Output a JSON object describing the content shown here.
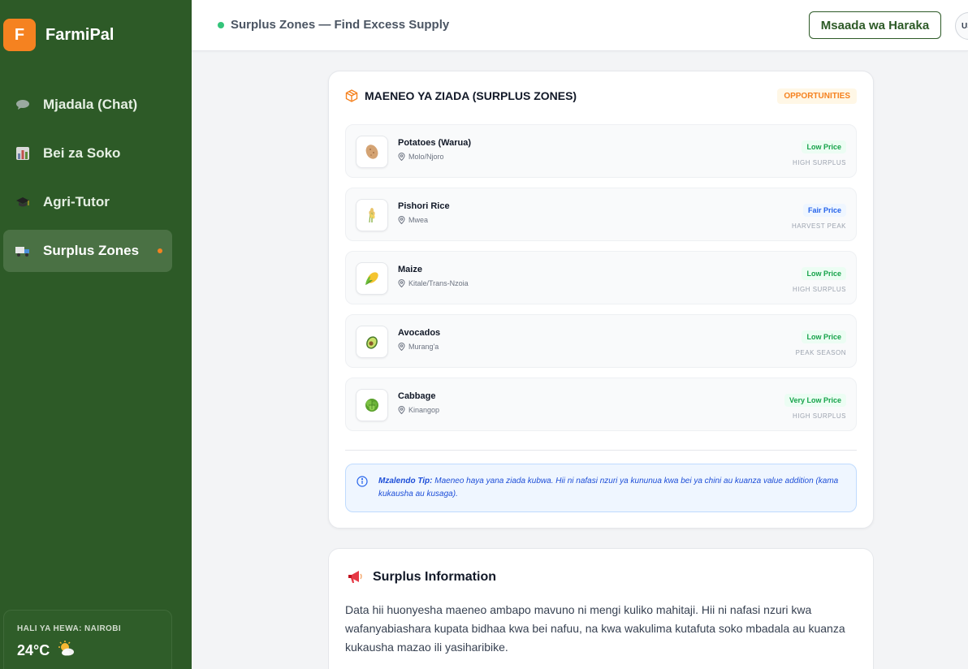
{
  "brand": {
    "logo_letter": "F",
    "name": "FarmiPal"
  },
  "sidebar": {
    "items": [
      {
        "label": "Mjadala (Chat)",
        "icon": "chat-bubble-icon"
      },
      {
        "label": "Bei za Soko",
        "icon": "chart-icon"
      },
      {
        "label": "Agri-Tutor",
        "icon": "graduation-cap-icon"
      },
      {
        "label": "Surplus Zones",
        "icon": "truck-icon",
        "active": true
      }
    ]
  },
  "weather": {
    "label": "HALI YA HEWA: NAIROBI",
    "temp": "24°C",
    "icon": "sun-cloud-icon"
  },
  "header": {
    "status": "Surplus Zones — Find Excess Supply",
    "help_button": "Msaada wa Haraka",
    "lang_button": "US"
  },
  "surplus": {
    "title": "MAENEO YA ZIADA (SURPLUS ZONES)",
    "badge": "OPPORTUNITIES",
    "items": [
      {
        "name": "Potatoes (Warua)",
        "location": "Molo/Njoro",
        "price": "Low Price",
        "price_type": "low",
        "note": "HIGH SURPLUS",
        "icon": "potato-icon"
      },
      {
        "name": "Pishori Rice",
        "location": "Mwea",
        "price": "Fair Price",
        "price_type": "fair",
        "note": "HARVEST PEAK",
        "icon": "rice-icon"
      },
      {
        "name": "Maize",
        "location": "Kitale/Trans-Nzoia",
        "price": "Low Price",
        "price_type": "low",
        "note": "HIGH SURPLUS",
        "icon": "maize-icon"
      },
      {
        "name": "Avocados",
        "location": "Murang'a",
        "price": "Low Price",
        "price_type": "low",
        "note": "PEAK SEASON",
        "icon": "avocado-icon"
      },
      {
        "name": "Cabbage",
        "location": "Kinangop",
        "price": "Very Low Price",
        "price_type": "low",
        "note": "HIGH SURPLUS",
        "icon": "cabbage-icon"
      }
    ],
    "tip_label": "Mzalendo Tip:",
    "tip_text": " Maeneo haya yana ziada kubwa. Hii ni nafasi nzuri ya kununua kwa bei ya chini au kuanza value addition (kama kukausha au kusaga)."
  },
  "info": {
    "title": "Surplus Information",
    "text": "Data hii huonyesha maeneo ambapo mavuno ni mengi kuliko mahitaji. Hii ni nafasi nzuri kwa wafanyabiashara kupata bidhaa kwa bei nafuu, na kwa wakulima kutafuta soko mbadala au kuanza kukausha mazao ili yasiharibike."
  },
  "colors": {
    "sidebar": "#2d5a27",
    "accent": "#f58220",
    "active_nav": "#4a7144"
  }
}
